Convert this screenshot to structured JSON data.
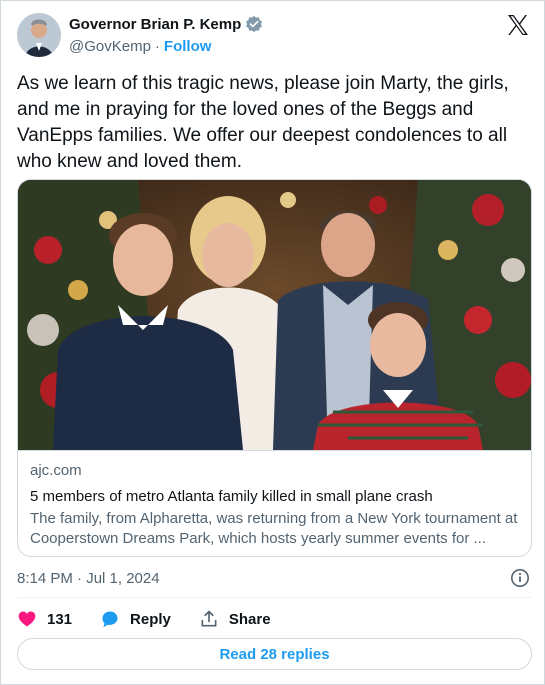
{
  "author": {
    "display_name": "Governor Brian P. Kemp",
    "handle": "@GovKemp",
    "separator": "·",
    "follow_label": "Follow"
  },
  "tweet": {
    "text": "As we learn of this tragic news, please join Marty, the girls, and me in praying for the loved ones of the Beggs and VanEpps families. We offer our deepest condolences to all who knew and loved them.",
    "timestamp": "8:14 PM · Jul 1, 2024"
  },
  "link_card": {
    "domain": "ajc.com",
    "title": "5 members of metro Atlanta family killed in small plane crash",
    "description": "The family, from Alpharetta, was returning from a New York tournament at Cooperstown Dreams Park, which hosts yearly summer events for ..."
  },
  "actions": {
    "like_count": "131",
    "reply_label": "Reply",
    "share_label": "Share"
  },
  "read_replies_label": "Read 28 replies",
  "colors": {
    "accent": "#1d9bf0",
    "like": "#f91880",
    "text": "#0f1419",
    "secondary": "#536471"
  },
  "icons": [
    "verified-badge-icon",
    "x-logo-icon",
    "info-icon",
    "heart-icon",
    "reply-bubble-icon",
    "share-icon"
  ]
}
